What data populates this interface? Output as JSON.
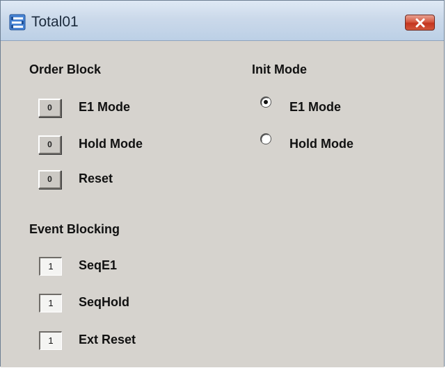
{
  "window": {
    "title": "Total01",
    "icon": "app-window-icon",
    "close_icon": "close-icon"
  },
  "order_block": {
    "title": "Order Block",
    "items": [
      {
        "button_value": "0",
        "label": "E1 Mode"
      },
      {
        "button_value": "0",
        "label": "Hold Mode"
      },
      {
        "button_value": "0",
        "label": "Reset"
      }
    ]
  },
  "init_mode": {
    "title": "Init Mode",
    "options": [
      {
        "label": "E1 Mode",
        "selected": true
      },
      {
        "label": "Hold Mode",
        "selected": false
      }
    ]
  },
  "event_blocking": {
    "title": "Event Blocking",
    "items": [
      {
        "value": "1",
        "label": "SeqE1"
      },
      {
        "value": "1",
        "label": "SeqHold"
      },
      {
        "value": "1",
        "label": "Ext Reset"
      }
    ]
  }
}
